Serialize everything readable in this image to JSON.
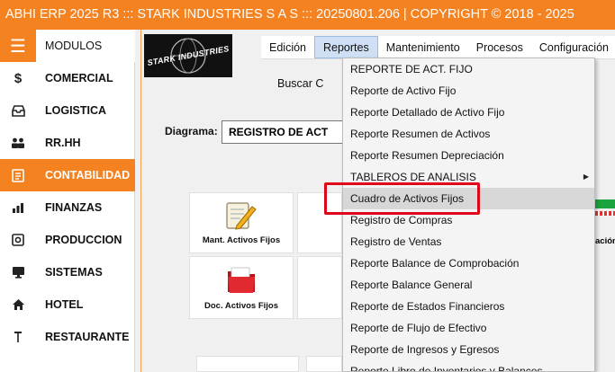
{
  "window": {
    "title": "ABHI ERP 2025 R3 ::: STARK INDUSTRIES S A S ::: 20250801.206 | COPYRIGHT ©  2018 - 2025"
  },
  "sidebar": {
    "items": [
      {
        "label": "MODULOS",
        "icon": "hamburger-icon",
        "glyph": "☰"
      },
      {
        "label": "COMERCIAL",
        "icon": "dollar-icon",
        "glyph": "$"
      },
      {
        "label": "LOGISTICA",
        "icon": "inbox-icon",
        "glyph": "🗃"
      },
      {
        "label": "RR.HH",
        "icon": "users-icon",
        "glyph": "👥"
      },
      {
        "label": "CONTABILIDAD",
        "icon": "ledger-icon",
        "glyph": "📒"
      },
      {
        "label": "FINANZAS",
        "icon": "bar-chart-icon",
        "glyph": "📊"
      },
      {
        "label": "PRODUCCION",
        "icon": "gear-box-icon",
        "glyph": "⚙"
      },
      {
        "label": "SISTEMAS",
        "icon": "monitor-icon",
        "glyph": "🖥"
      },
      {
        "label": "HOTEL",
        "icon": "home-icon",
        "glyph": "⌂"
      },
      {
        "label": "RESTAURANTE",
        "icon": "pin-icon",
        "glyph": "⚲"
      }
    ],
    "active_index": 4,
    "accent": "#f58220"
  },
  "logo": {
    "text": "STARK INDUSTRIES"
  },
  "menubar": {
    "items": [
      "Edición",
      "Reportes",
      "Mantenimiento",
      "Procesos",
      "Configuración"
    ],
    "open_index": 1
  },
  "search": {
    "label": "Buscar C"
  },
  "diagram": {
    "label": "Diagrama:",
    "value": "REGISTRO DE ACT"
  },
  "tiles": [
    {
      "caption": "Mant. Activos Fijos",
      "icon": "notepad-pencil-icon"
    },
    {
      "caption": "Doc. Activos Fijos",
      "icon": "red-folder-icon"
    }
  ],
  "right_caption": "ación",
  "reportes_menu": {
    "items": [
      "REPORTE DE ACT. FIJO",
      "Reporte de Activo Fijo",
      "Reporte Detallado de Activo Fijo",
      "Reporte Resumen de Activos",
      "Reporte Resumen Depreciación",
      "TABLEROS DE ANALISIS",
      "Cuadro de Activos Fijos",
      "Registro de Compras",
      "Registro de Ventas",
      "Reporte Balance de Comprobación",
      "Reporte Balance General",
      "Reporte de Estados Financieros",
      "Reporte de Flujo de Efectivo",
      "Reporte de Ingresos y Egresos",
      "Reporte Libro de Inventarios y Balances"
    ],
    "submenu_index": 5,
    "hover_index": 6,
    "highlight_color": "#e0061a"
  }
}
